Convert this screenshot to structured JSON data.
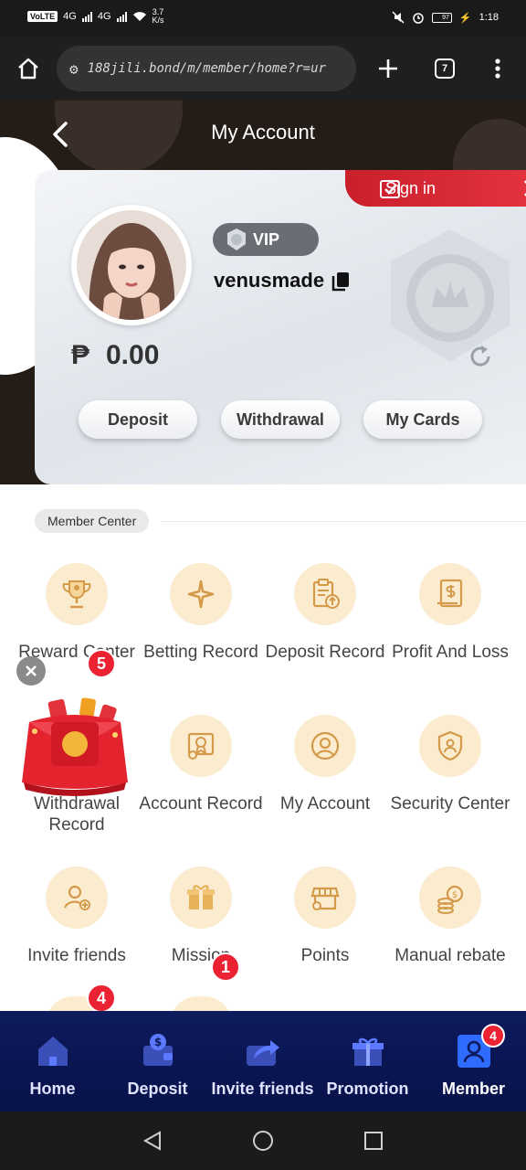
{
  "status_bar": {
    "volte": "VoLTE",
    "network1": "4G",
    "network2": "4G",
    "speed": "3.7",
    "speed_unit": "K/s",
    "battery_level": "97",
    "time": "1:18"
  },
  "browser": {
    "url": "188jili.bond/m/member/home?r=ur",
    "tab_count": "7"
  },
  "header": {
    "title": "My Account"
  },
  "account_card": {
    "sign_in_label": "Sign in",
    "vip_label": "VIP",
    "username": "venusmade",
    "currency_symbol": "₱",
    "balance": "0.00",
    "actions": [
      "Deposit",
      "Withdrawal",
      "My Cards"
    ]
  },
  "member_center": {
    "label": "Member Center",
    "items": [
      {
        "label": "Reward Center",
        "icon": "trophy-icon",
        "badge": "5"
      },
      {
        "label": "Betting Record",
        "icon": "sparkle-icon"
      },
      {
        "label": "Deposit Record",
        "icon": "clipboard-upload-icon"
      },
      {
        "label": "Profit And Loss",
        "icon": "document-dollar-icon"
      },
      {
        "label": "Withdrawal Record",
        "icon": "red-envelope-icon"
      },
      {
        "label": "Account Record",
        "icon": "certificate-icon"
      },
      {
        "label": "My Account",
        "icon": "user-circle-icon"
      },
      {
        "label": "Security Center",
        "icon": "shield-user-icon"
      },
      {
        "label": "Invite friends",
        "icon": "add-user-icon"
      },
      {
        "label": "Mission",
        "icon": "gift-icon",
        "badge": "1"
      },
      {
        "label": "Points",
        "icon": "shop-icon"
      },
      {
        "label": "Manual rebate",
        "icon": "coins-icon"
      }
    ],
    "partial_row_badge": "4"
  },
  "bottom_nav": {
    "items": [
      {
        "label": "Home",
        "icon": "home-icon"
      },
      {
        "label": "Deposit",
        "icon": "wallet-icon"
      },
      {
        "label": "Invite friends",
        "icon": "share-icon"
      },
      {
        "label": "Promotion",
        "icon": "gift-icon"
      },
      {
        "label": "Member",
        "icon": "member-icon",
        "badge": "4",
        "active": true
      }
    ]
  },
  "colors": {
    "accent_red": "#ea2232",
    "nav_bg": "#0d1a5c",
    "icon_circle": "#fbecd0",
    "icon_stroke": "#d49a4a"
  }
}
